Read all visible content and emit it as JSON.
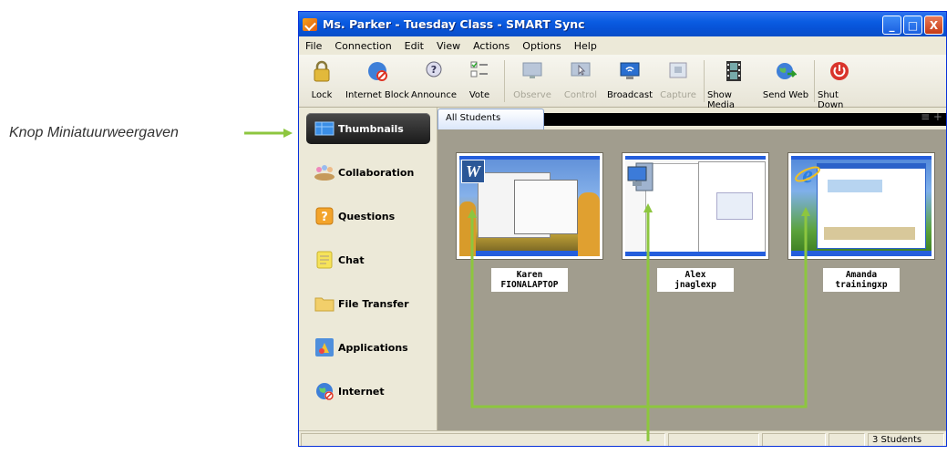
{
  "callout": {
    "text": "Knop Miniatuurweergaven"
  },
  "window": {
    "title": "Ms. Parker - Tuesday Class - SMART Sync",
    "buttons": [
      "_",
      "□",
      "X"
    ]
  },
  "menu": [
    "File",
    "Connection",
    "Edit",
    "View",
    "Actions",
    "Options",
    "Help"
  ],
  "toolbar": [
    {
      "label": "Lock",
      "icon": "lock-icon",
      "enabled": true
    },
    {
      "label": "Internet Block",
      "icon": "internet-block-icon",
      "enabled": true
    },
    {
      "label": "Announce",
      "icon": "announce-icon",
      "enabled": true
    },
    {
      "label": "Vote",
      "icon": "vote-icon",
      "enabled": true
    },
    {
      "label": "Observe",
      "icon": "observe-icon",
      "enabled": false
    },
    {
      "label": "Control",
      "icon": "control-icon",
      "enabled": false
    },
    {
      "label": "Broadcast",
      "icon": "broadcast-icon",
      "enabled": true
    },
    {
      "label": "Capture",
      "icon": "capture-icon",
      "enabled": false
    },
    {
      "label": "Show Media",
      "icon": "show-media-icon",
      "enabled": true
    },
    {
      "label": "Send Web",
      "icon": "send-web-icon",
      "enabled": true
    },
    {
      "label": "Shut Down",
      "icon": "shut-down-icon",
      "enabled": true
    }
  ],
  "sidebar": {
    "items": [
      {
        "label": "Thumbnails",
        "icon": "thumbnails-icon",
        "active": true
      },
      {
        "label": "Collaboration",
        "icon": "collaboration-icon",
        "active": false
      },
      {
        "label": "Questions",
        "icon": "questions-icon",
        "active": false
      },
      {
        "label": "Chat",
        "icon": "chat-icon",
        "active": false
      },
      {
        "label": "File Transfer",
        "icon": "folder-icon",
        "active": false
      },
      {
        "label": "Applications",
        "icon": "applications-icon",
        "active": false
      },
      {
        "label": "Internet",
        "icon": "internet-icon",
        "active": false
      }
    ]
  },
  "tab": {
    "label": "All Students"
  },
  "students": [
    {
      "name": "Karen",
      "computer": "FIONALAPTOP",
      "app_icon": "word-icon"
    },
    {
      "name": "Alex",
      "computer": "jnaglexp",
      "app_icon": "computer-icon"
    },
    {
      "name": "Amanda",
      "computer": "trainingxp",
      "app_icon": "internet-explorer-icon"
    }
  ],
  "status": {
    "count": "3 Students"
  },
  "colors": {
    "arrow": "#8dc63f",
    "titlebar": "#0a5ce2"
  }
}
